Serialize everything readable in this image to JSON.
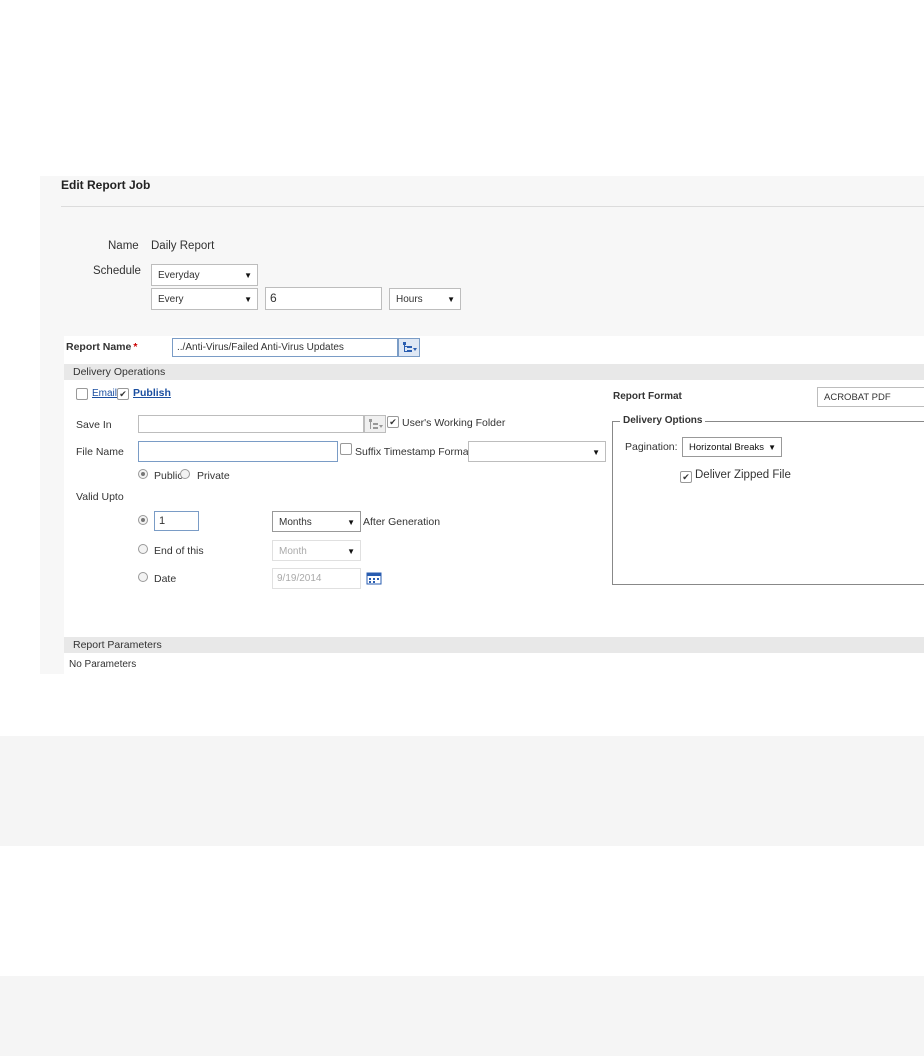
{
  "header": {
    "title": "Edit Report Job"
  },
  "job": {
    "name_label": "Name",
    "name_value": "Daily Report",
    "schedule_label": "Schedule",
    "schedule_freq": "Everyday",
    "schedule_every": "Every",
    "schedule_count": "6",
    "schedule_unit": "Hours"
  },
  "report": {
    "name_label": "Report Name",
    "required_mark": "*",
    "path": "../Anti-Virus/Failed Anti-Virus Updates"
  },
  "delivery": {
    "section_title": "Delivery Operations",
    "email_label": "Email",
    "email_checked": false,
    "publish_label": "Publish",
    "publish_checked": true,
    "save_in_label": "Save In",
    "save_in_value": "",
    "users_working_folder_label": "User's Working Folder",
    "users_working_folder_checked": true,
    "file_name_label": "File Name",
    "file_name_value": "",
    "suffix_timestamp_label": "Suffix Timestamp Format",
    "suffix_timestamp_value": "",
    "public_label": "Public",
    "private_label": "Private",
    "visibility_selected": "Public",
    "valid_upto_label": "Valid Upto",
    "valid_count": "1",
    "valid_unit": "Months",
    "after_generation_label": "After Generation",
    "end_of_this_label": "End of this",
    "end_of_this_unit": "Month",
    "date_label": "Date",
    "date_value": "9/19/2014",
    "valid_selected": "count"
  },
  "format": {
    "label": "Report Format",
    "value": "ACROBAT PDF",
    "options_title": "Delivery Options",
    "pagination_label": "Pagination:",
    "pagination_value": "Horizontal Breaks",
    "zipped_label": "Deliver Zipped File",
    "zipped_checked": true
  },
  "parameters": {
    "section_title": "Report Parameters",
    "empty_text": "No Parameters"
  },
  "colors": {
    "link": "#1a4ea0",
    "required": "#cc0000",
    "section_bar": "#e8e8e8",
    "panel": "#f7f7f7"
  },
  "icons": [
    "folder-tree-icon",
    "calendar-icon",
    "check-icon",
    "dropdown-arrow-icon"
  ]
}
